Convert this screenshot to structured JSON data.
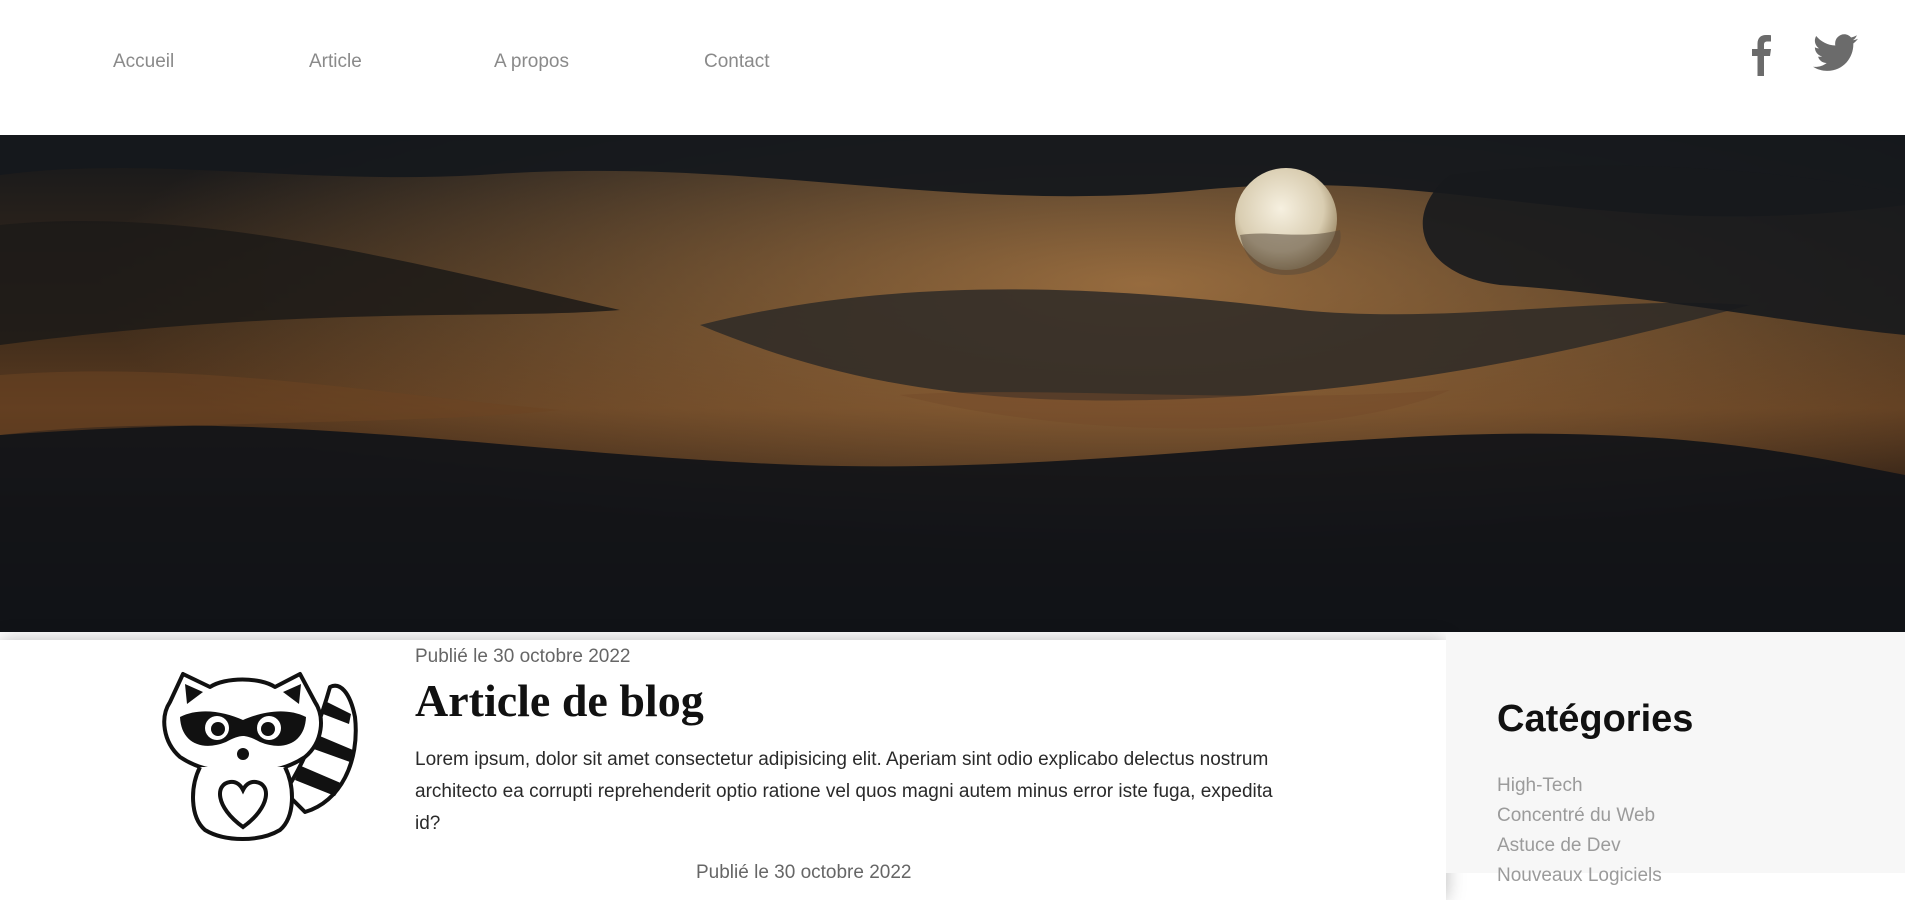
{
  "nav": {
    "items": [
      {
        "label": "Accueil"
      },
      {
        "label": "Article"
      },
      {
        "label": "A propos"
      },
      {
        "label": "Contact"
      }
    ]
  },
  "social": {
    "icons": [
      "facebook-icon",
      "twitter-icon"
    ],
    "color": "#6b6b6b"
  },
  "post": {
    "date": "Publié le 30 octobre 2022",
    "title": "Article de blog",
    "excerpt": "Lorem ipsum, dolor sit amet consectetur adipisicing elit. Aperiam sint odio explicabo delectus nostrum architecto ea corrupti reprehenderit optio ratione vel quos magni autem minus error iste fuga, expedita id?",
    "next_date": "Publié le 30 octobre 2022"
  },
  "sidebar": {
    "title": "Catégories",
    "categories": [
      "High-Tech",
      "Concentré du Web",
      "Astuce de Dev",
      "Nouveaux Logiciels"
    ]
  }
}
